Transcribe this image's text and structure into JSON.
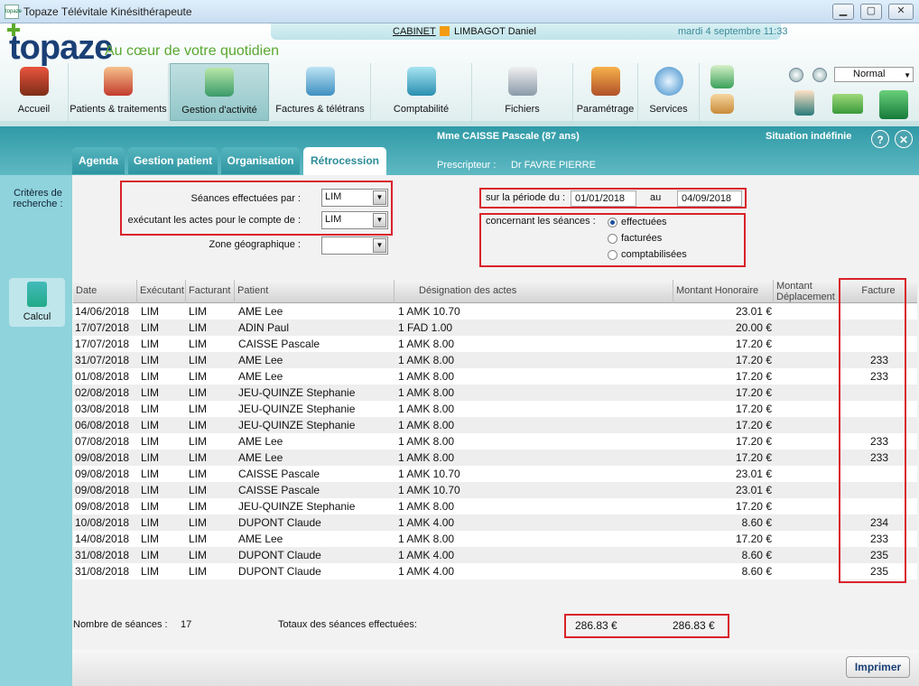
{
  "window": {
    "title": "Topaze Télévitale Kinésithérapeute",
    "app_icon_text": "topaze",
    "buttons": [
      "minimize",
      "maximize",
      "close"
    ]
  },
  "header": {
    "logo": "topaze",
    "tagline": "Au cœur de votre quotidien",
    "cabinet": "CABINET",
    "practitioner": "LIMBAGOT Daniel",
    "date": "mardi 4 septembre 11:33",
    "mode": "Normal"
  },
  "nav": [
    {
      "label": "Accueil",
      "icon": "house-icon"
    },
    {
      "label": "Patients & traitements",
      "icon": "patients-icon"
    },
    {
      "label": "Gestion d'activité",
      "icon": "activity-icon",
      "active": true
    },
    {
      "label": "Factures & télétrans",
      "icon": "invoice-icon"
    },
    {
      "label": "Comptabilité",
      "icon": "calculator-lock-icon"
    },
    {
      "label": "Fichiers",
      "icon": "database-icon"
    },
    {
      "label": "Paramétrage",
      "icon": "gears-icon"
    },
    {
      "label": "Services",
      "icon": "globe-icon"
    }
  ],
  "tabs": [
    {
      "label": "Agenda"
    },
    {
      "label": "Gestion patient"
    },
    {
      "label": "Organisation"
    },
    {
      "label": "Rétrocession",
      "active": true
    }
  ],
  "patient_bar": {
    "patient": "Mme CAISSE Pascale (87 ans)",
    "situation": "Situation indéfinie",
    "prescriber_label": "Prescripteur :",
    "prescriber": "Dr FAVRE PIERRE",
    "help": "?",
    "close": "✕"
  },
  "sidebar": {
    "criteria": "Critères de recherche :",
    "calc_label": "Calcul"
  },
  "criteria": {
    "seances_label": "Séances effectuées par :",
    "seances_value": "LIM",
    "executant_label": "exécutant les actes pour le compte de :",
    "executant_value": "LIM",
    "zone_label": "Zone géographique :",
    "zone_value": "",
    "period_label": "sur la période du :",
    "period_from": "01/01/2018",
    "period_au": "au",
    "period_to": "04/09/2018",
    "concern_label": "concernant les séances :",
    "options": [
      {
        "label": "effectuées",
        "checked": true
      },
      {
        "label": "facturées",
        "checked": false
      },
      {
        "label": "comptabilisées",
        "checked": false
      }
    ]
  },
  "table": {
    "headers": [
      "Date",
      "Exécutant",
      "Facturant",
      "Patient",
      "Désignation des actes",
      "Montant Honoraire",
      "Montant Déplacement",
      "Facture"
    ],
    "rows": [
      [
        "14/06/2018",
        "LIM",
        "LIM",
        "AME Lee",
        "1 AMK 10.70",
        "23.01 €",
        "",
        ""
      ],
      [
        "17/07/2018",
        "LIM",
        "LIM",
        "ADIN Paul",
        "1 FAD 1.00",
        "20.00 €",
        "",
        ""
      ],
      [
        "17/07/2018",
        "LIM",
        "LIM",
        "CAISSE Pascale",
        "1 AMK 8.00",
        "17.20 €",
        "",
        ""
      ],
      [
        "31/07/2018",
        "LIM",
        "LIM",
        "AME Lee",
        "1 AMK 8.00",
        "17.20 €",
        "",
        "233"
      ],
      [
        "01/08/2018",
        "LIM",
        "LIM",
        "AME Lee",
        "1 AMK 8.00",
        "17.20 €",
        "",
        "233"
      ],
      [
        "02/08/2018",
        "LIM",
        "LIM",
        "JEU-QUINZE Stephanie",
        "1 AMK 8.00",
        "17.20 €",
        "",
        ""
      ],
      [
        "03/08/2018",
        "LIM",
        "LIM",
        "JEU-QUINZE Stephanie",
        "1 AMK 8.00",
        "17.20 €",
        "",
        ""
      ],
      [
        "06/08/2018",
        "LIM",
        "LIM",
        "JEU-QUINZE Stephanie",
        "1 AMK 8.00",
        "17.20 €",
        "",
        ""
      ],
      [
        "07/08/2018",
        "LIM",
        "LIM",
        "AME Lee",
        "1 AMK 8.00",
        "17.20 €",
        "",
        "233"
      ],
      [
        "09/08/2018",
        "LIM",
        "LIM",
        "AME Lee",
        "1 AMK 8.00",
        "17.20 €",
        "",
        "233"
      ],
      [
        "09/08/2018",
        "LIM",
        "LIM",
        "CAISSE Pascale",
        "1 AMK 10.70",
        "23.01 €",
        "",
        ""
      ],
      [
        "09/08/2018",
        "LIM",
        "LIM",
        "CAISSE Pascale",
        "1 AMK 10.70",
        "23.01 €",
        "",
        ""
      ],
      [
        "09/08/2018",
        "LIM",
        "LIM",
        "JEU-QUINZE Stephanie",
        "1 AMK 8.00",
        "17.20 €",
        "",
        ""
      ],
      [
        "10/08/2018",
        "LIM",
        "LIM",
        "DUPONT Claude",
        "1 AMK 4.00",
        "8.60 €",
        "",
        "234"
      ],
      [
        "14/08/2018",
        "LIM",
        "LIM",
        "AME Lee",
        "1 AMK 8.00",
        "17.20 €",
        "",
        "233"
      ],
      [
        "31/08/2018",
        "LIM",
        "LIM",
        "DUPONT Claude",
        "1 AMK 4.00",
        "8.60 €",
        "",
        "235"
      ],
      [
        "31/08/2018",
        "LIM",
        "LIM",
        "DUPONT Claude",
        "1 AMK 4.00",
        "8.60 €",
        "",
        "235"
      ]
    ]
  },
  "footer": {
    "nb_label": "Nombre de séances :",
    "nb_value": "17",
    "totals_label": "Totaux des séances effectuées:",
    "total_honoraire": "286.83 €",
    "total_global": "286.83 €",
    "print": "Imprimer"
  },
  "colors": {
    "teal": "#2f9aa6",
    "accent_red": "#d9222a",
    "logo_blue": "#1a3f75",
    "logo_green": "#5cab2a"
  }
}
